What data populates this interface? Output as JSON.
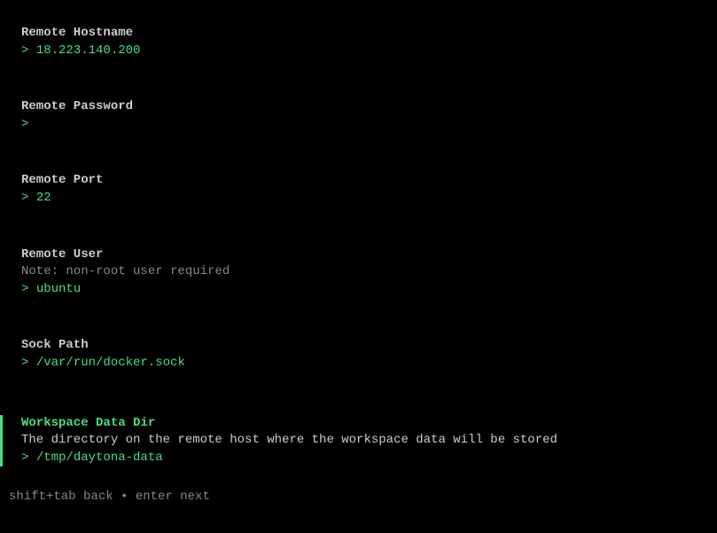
{
  "fields": {
    "hostname": {
      "label": "Remote Hostname",
      "value": "18.223.140.200"
    },
    "password": {
      "label": "Remote Password",
      "value": ""
    },
    "port": {
      "label": "Remote Port",
      "value": "22"
    },
    "user": {
      "label": "Remote User",
      "note": "Note: non-root user required",
      "value": "ubuntu"
    },
    "sock_path": {
      "label": "Sock Path",
      "value": "/var/run/docker.sock"
    },
    "workspace_data_dir": {
      "label": "Workspace Data Dir",
      "description": "The directory on the remote host where the workspace data will be stored",
      "value": "/tmp/daytona-data"
    }
  },
  "prompt": ">",
  "hints": {
    "back": "shift+tab back",
    "separator": "•",
    "next": "enter next"
  }
}
